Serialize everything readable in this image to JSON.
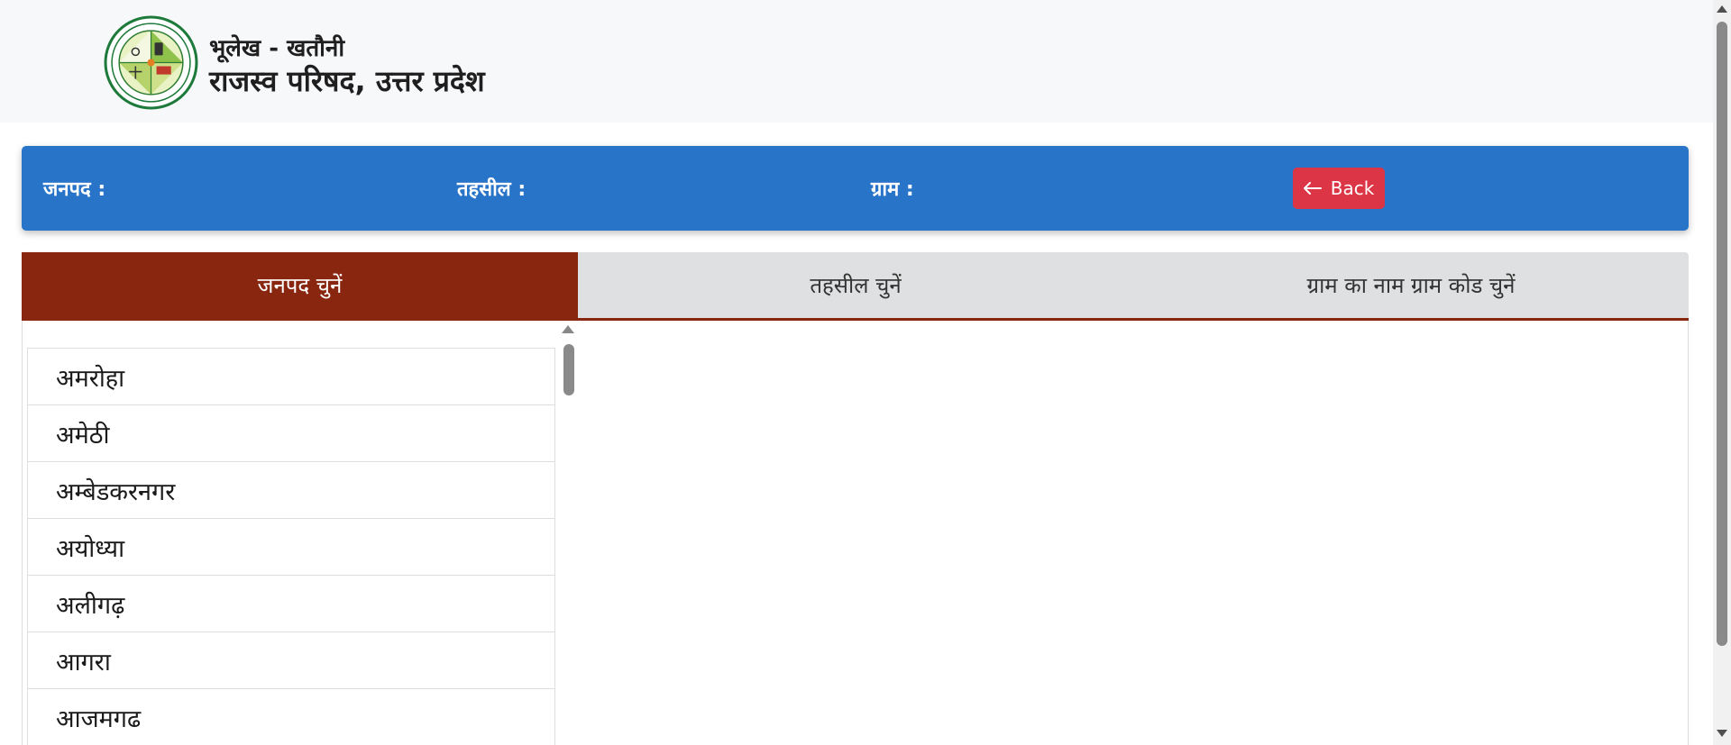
{
  "header": {
    "subtitle": "भूलेख - खतौनी",
    "title": "राजस्व परिषद, उत्तर प्रदेश",
    "logo_icon": "revenue-board-seal-icon"
  },
  "filters": {
    "district_label": "जनपद :",
    "tehsil_label": "तहसील :",
    "village_label": "ग्राम :",
    "back_label": "Back",
    "back_icon": "arrow-left-icon"
  },
  "tabs": [
    {
      "label": "जनपद चुनें",
      "active": true
    },
    {
      "label": "तहसील चुनें",
      "active": false
    },
    {
      "label": "ग्राम का नाम ग्राम कोड चुनें",
      "active": false
    }
  ],
  "districts": [
    "अमरोहा",
    "अमेठी",
    "अम्बेडकरनगर",
    "अयोध्या",
    "अलीगढ़",
    "आगरा",
    "आजमगढ"
  ],
  "colors": {
    "filterbar": "#2874c8",
    "active_tab": "#88260f",
    "inactive_tab": "#dee0e1",
    "back_button": "#dc3545",
    "header_bg": "#f7f8fa"
  }
}
